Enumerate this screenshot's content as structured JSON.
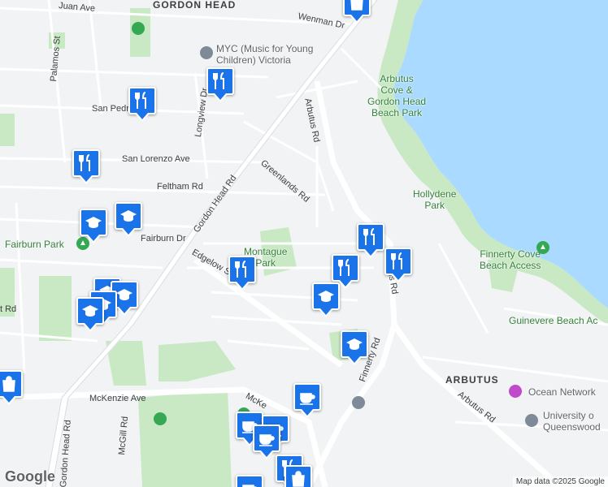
{
  "map": {
    "roads": [
      "Gordon Head Rd",
      "Feltham Rd",
      "Greenlands Rd",
      "Arbutus Rd",
      "Fairburn Dr",
      "Edgelow St",
      "Finnerty Rd",
      "McKenzie Ave",
      "McGill Rd",
      "Longview Dr",
      "San Lorenzo Ave",
      "San Pedro",
      "Palamos St",
      "Wenman Dr",
      "Juan Ave",
      "McKe",
      "t Rd"
    ],
    "roads_partial": {
      "arbutus_lower": "tus Rd"
    },
    "parks": [
      "Arbutus Cove & Gordon Head Beach Park",
      "Hollydene Park",
      "Montague Park",
      "Fairburn Park",
      "Finnerty Cove Beach Access"
    ],
    "parks_lines": {
      "arbutus": [
        "Arbutus",
        "Cove &",
        "Gordon Head",
        "Beach Park"
      ],
      "hollydene": [
        "Hollydene",
        "Park"
      ],
      "montague": [
        "Montague",
        "Park"
      ],
      "finnerty": [
        "Finnerty Cove",
        "Beach Access"
      ]
    },
    "pois": {
      "myc": [
        "MYC (Music for Young",
        "Children) Victoria"
      ],
      "guinevere": "Guinevere Beach Ac",
      "ocean": "Ocean Network",
      "uvic": [
        "University o",
        "Queenswood"
      ]
    },
    "districts": [
      "GORDON HEAD",
      "ARBUTUS"
    ],
    "attribution": "Map data ©2025 Google",
    "logo": "Google"
  }
}
